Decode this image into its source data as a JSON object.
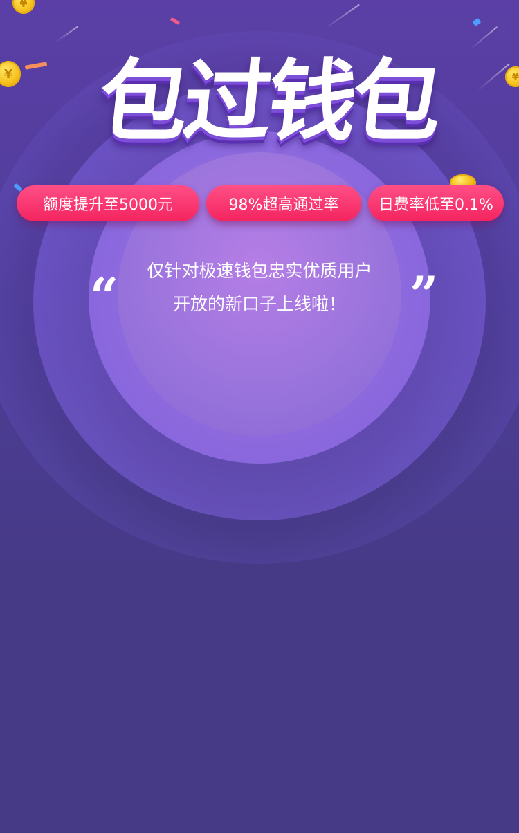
{
  "hero": {
    "title": "包过钱包"
  },
  "tags": [
    {
      "label": "额度提升至5000元"
    },
    {
      "label": "98%超高通过率"
    },
    {
      "label": "日费率低至0.1%"
    }
  ],
  "slogan": {
    "open_quote": "“",
    "close_quote": "”",
    "line1": "仅针对极速钱包忠实优质用户",
    "line2": "开放的新口子上线啦！"
  },
  "decor": {
    "coin_symbol": "¥",
    "colors": {
      "background": "#463a86",
      "pill": "#f4245f",
      "title_shadow": "#5a2fb0",
      "coin": "#f6c21c"
    }
  }
}
